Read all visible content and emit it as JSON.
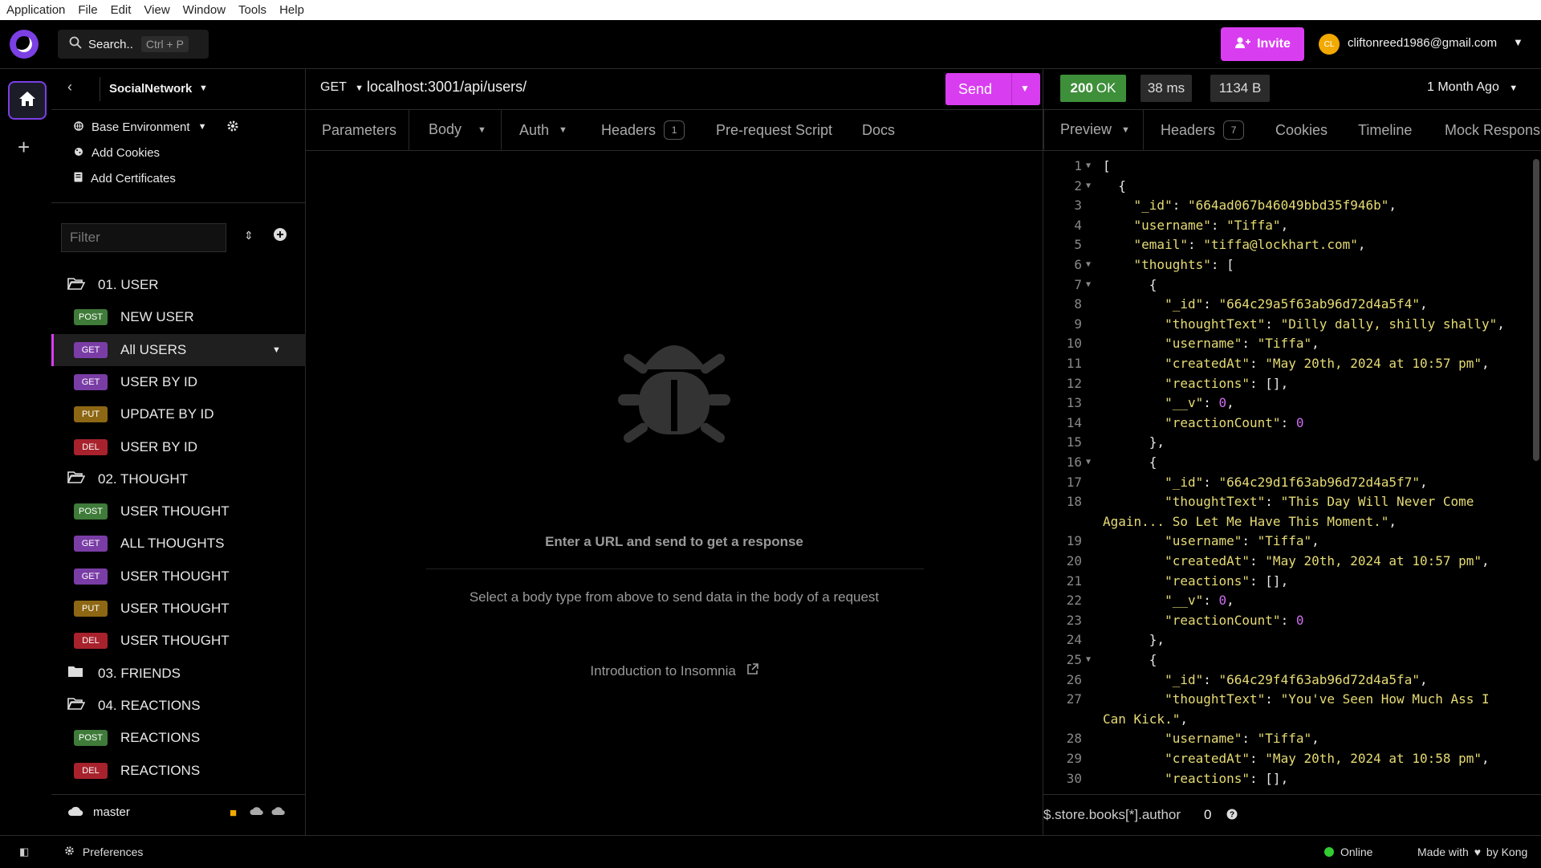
{
  "menubar": {
    "items": [
      "Application",
      "File",
      "Edit",
      "View",
      "Window",
      "Tools",
      "Help"
    ]
  },
  "topbar": {
    "search_label": "Search..",
    "search_shortcut": "Ctrl + P",
    "invite_label": "Invite",
    "avatar_initials": "CL",
    "user_email": "cliftonreed1986@gmail.com"
  },
  "sidebar": {
    "project_name": "SocialNetwork",
    "environment": "Base Environment",
    "add_cookies": "Add Cookies",
    "add_certificates": "Add Certificates",
    "filter_placeholder": "Filter",
    "tree": [
      {
        "kind": "folder",
        "label": "01. USER",
        "open": true
      },
      {
        "kind": "request",
        "method": "POST",
        "label": "NEW USER"
      },
      {
        "kind": "request",
        "method": "GET",
        "label": "All USERS",
        "active": true
      },
      {
        "kind": "request",
        "method": "GET",
        "label": "USER BY ID"
      },
      {
        "kind": "request",
        "method": "PUT",
        "label": "UPDATE BY ID"
      },
      {
        "kind": "request",
        "method": "DEL",
        "label": "USER BY ID"
      },
      {
        "kind": "folder",
        "label": "02. THOUGHT",
        "open": true
      },
      {
        "kind": "request",
        "method": "POST",
        "label": "USER THOUGHT"
      },
      {
        "kind": "request",
        "method": "GET",
        "label": "ALL THOUGHTS"
      },
      {
        "kind": "request",
        "method": "GET",
        "label": "USER THOUGHT"
      },
      {
        "kind": "request",
        "method": "PUT",
        "label": "USER THOUGHT"
      },
      {
        "kind": "request",
        "method": "DEL",
        "label": "USER THOUGHT"
      },
      {
        "kind": "folder",
        "label": "03. FRIENDS",
        "open": false
      },
      {
        "kind": "folder",
        "label": "04. REACTIONS",
        "open": true
      },
      {
        "kind": "request",
        "method": "POST",
        "label": "REACTIONS"
      },
      {
        "kind": "request",
        "method": "DEL",
        "label": "REACTIONS"
      }
    ],
    "branch": "master"
  },
  "request": {
    "method": "GET",
    "url": "localhost:3001/api/users/",
    "send_label": "Send",
    "tabs": [
      "Parameters",
      "Body",
      "Auth",
      "Headers",
      "Pre-request Script",
      "Docs"
    ],
    "headers_count": "1",
    "empty_title": "Enter a URL and send to get a response",
    "empty_sub": "Select a body type from above to send data in the body of a request",
    "intro_link": "Introduction to Insomnia"
  },
  "response": {
    "status": "200",
    "status_text": "OK",
    "time": "38 ms",
    "size": "1134 B",
    "age": "1 Month Ago",
    "tabs": [
      "Preview",
      "Headers",
      "Cookies",
      "Timeline",
      "Mock Response"
    ],
    "headers_count": "7",
    "filter_query": "$.store.books[*].author",
    "filter_count": "0",
    "lines": [
      {
        "n": "1",
        "fold": true,
        "html": "["
      },
      {
        "n": "2",
        "fold": true,
        "html": "  {"
      },
      {
        "n": "3",
        "html": "    <span class='key'>\"_id\"</span>: <span class='str'>\"664ad067b46049bbd35f946b\"</span>,"
      },
      {
        "n": "4",
        "html": "    <span class='key'>\"username\"</span>: <span class='str'>\"Tiffa\"</span>,"
      },
      {
        "n": "5",
        "html": "    <span class='key'>\"email\"</span>: <span class='str'>\"tiffa@lockhart.com\"</span>,"
      },
      {
        "n": "6",
        "fold": true,
        "html": "    <span class='key'>\"thoughts\"</span>: ["
      },
      {
        "n": "7",
        "fold": true,
        "html": "      {"
      },
      {
        "n": "8",
        "html": "        <span class='key'>\"_id\"</span>: <span class='str'>\"664c29a5f63ab96d72d4a5f4\"</span>,"
      },
      {
        "n": "9",
        "html": "        <span class='key'>\"thoughtText\"</span>: <span class='str'>\"Dilly dally, shilly shally\"</span>,"
      },
      {
        "n": "10",
        "html": "        <span class='key'>\"username\"</span>: <span class='str'>\"Tiffa\"</span>,"
      },
      {
        "n": "11",
        "html": "        <span class='key'>\"createdAt\"</span>: <span class='str'>\"May 20th, 2024 at 10:57 pm\"</span>,"
      },
      {
        "n": "12",
        "html": "        <span class='key'>\"reactions\"</span>: [],"
      },
      {
        "n": "13",
        "html": "        <span class='key'>\"__v\"</span>: <span class='num'>0</span>,"
      },
      {
        "n": "14",
        "html": "        <span class='key'>\"reactionCount\"</span>: <span class='num'>0</span>"
      },
      {
        "n": "15",
        "html": "      },"
      },
      {
        "n": "16",
        "fold": true,
        "html": "      {"
      },
      {
        "n": "17",
        "html": "        <span class='key'>\"_id\"</span>: <span class='str'>\"664c29d1f63ab96d72d4a5f7\"</span>,"
      },
      {
        "n": "18",
        "html": "        <span class='key'>\"thoughtText\"</span>: <span class='str'>\"This Day Will Never Come</span>"
      },
      {
        "n": "",
        "html": "<span class='str'>Again... So Let Me Have This Moment.\"</span>,"
      },
      {
        "n": "19",
        "html": "        <span class='key'>\"username\"</span>: <span class='str'>\"Tiffa\"</span>,"
      },
      {
        "n": "20",
        "html": "        <span class='key'>\"createdAt\"</span>: <span class='str'>\"May 20th, 2024 at 10:57 pm\"</span>,"
      },
      {
        "n": "21",
        "html": "        <span class='key'>\"reactions\"</span>: [],"
      },
      {
        "n": "22",
        "html": "        <span class='key'>\"__v\"</span>: <span class='num'>0</span>,"
      },
      {
        "n": "23",
        "html": "        <span class='key'>\"reactionCount\"</span>: <span class='num'>0</span>"
      },
      {
        "n": "24",
        "html": "      },"
      },
      {
        "n": "25",
        "fold": true,
        "html": "      {"
      },
      {
        "n": "26",
        "html": "        <span class='key'>\"_id\"</span>: <span class='str'>\"664c29f4f63ab96d72d4a5fa\"</span>,"
      },
      {
        "n": "27",
        "html": "        <span class='key'>\"thoughtText\"</span>: <span class='str'>\"You've Seen How Much Ass I</span>"
      },
      {
        "n": "",
        "html": "<span class='str'>Can Kick.\"</span>,"
      },
      {
        "n": "28",
        "html": "        <span class='key'>\"username\"</span>: <span class='str'>\"Tiffa\"</span>,"
      },
      {
        "n": "29",
        "html": "        <span class='key'>\"createdAt\"</span>: <span class='str'>\"May 20th, 2024 at 10:58 pm\"</span>,"
      },
      {
        "n": "30",
        "html": "        <span class='key'>\"reactions\"</span>: [],"
      }
    ]
  },
  "footer": {
    "preferences": "Preferences",
    "online": "Online",
    "made_with": "Made with",
    "by_kong": "by Kong"
  },
  "colors": {
    "accent": "#d93df0",
    "brand": "#7b3fe4",
    "status_ok": "#3e8f3a",
    "online": "#33cc33"
  }
}
